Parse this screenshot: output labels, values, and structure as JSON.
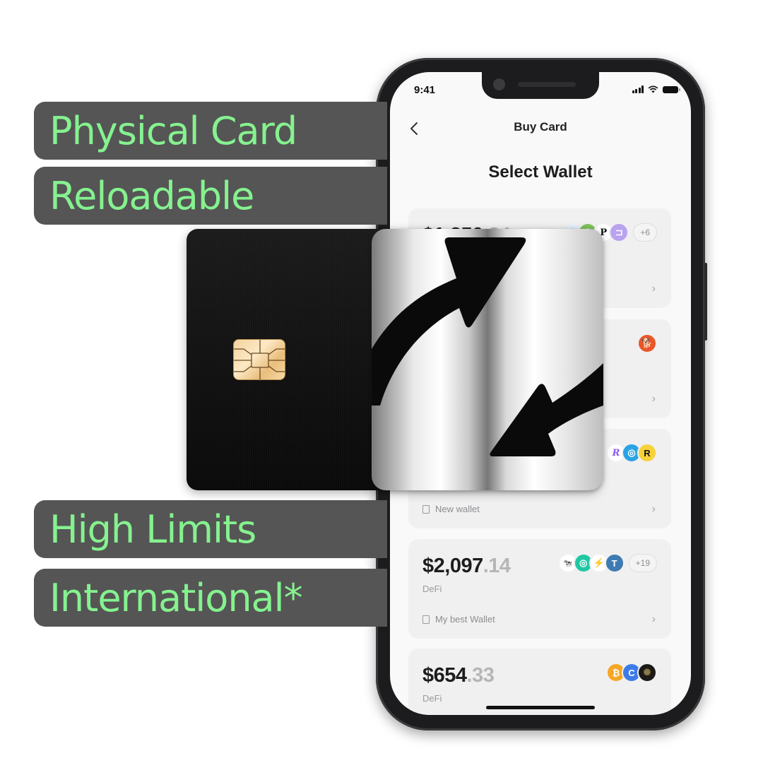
{
  "features": [
    {
      "label": "Physical Card"
    },
    {
      "label": "Reloadable"
    },
    {
      "label": "High Limits"
    },
    {
      "label": "International*"
    }
  ],
  "colors": {
    "feature_text": "#85f28f",
    "feature_bg": "#555555",
    "screen_bg": "#f9f9f9",
    "card_bg": "#f0f0f1"
  },
  "status_bar": {
    "time": "9:41",
    "icons": [
      "signal-icon",
      "wifi-icon",
      "battery-icon"
    ]
  },
  "nav": {
    "back_icon": "chevron-left-icon",
    "title": "Buy Card"
  },
  "page": {
    "title": "Select Wallet"
  },
  "wallets": [
    {
      "amount_whole": "$1,250",
      "amount_cents": ".24",
      "type": "",
      "name": "",
      "coins": [
        "snowflake-coin",
        "green-gear-coin",
        "polkadot-coin",
        "purple-square-coin"
      ],
      "more": "+6"
    },
    {
      "amount_whole": "",
      "amount_cents": "",
      "type": "",
      "name": "",
      "coins": [
        "shiba-coin"
      ],
      "more": ""
    },
    {
      "amount_whole": "",
      "amount_cents": "",
      "type": "",
      "name": "New wallet",
      "coins": [
        "r-script-coin",
        "blue-ring-coin",
        "yellow-r-coin"
      ],
      "more": ""
    },
    {
      "amount_whole": "$2,097",
      "amount_cents": ".14",
      "type": "DeFi",
      "name": "My best Wallet",
      "coins": [
        "cow-coin",
        "teal-ring-coin",
        "lightning-coin",
        "t-coin"
      ],
      "more": "+19"
    },
    {
      "amount_whole": "$654",
      "amount_cents": ".33",
      "type": "DeFi",
      "name": "",
      "coins": [
        "bitcoin-coin",
        "blue-c-coin",
        "dark-gold-coin"
      ],
      "more": ""
    }
  ],
  "card": {
    "chip": "emv-chip-icon",
    "logo": "swap-arrows-logo"
  }
}
